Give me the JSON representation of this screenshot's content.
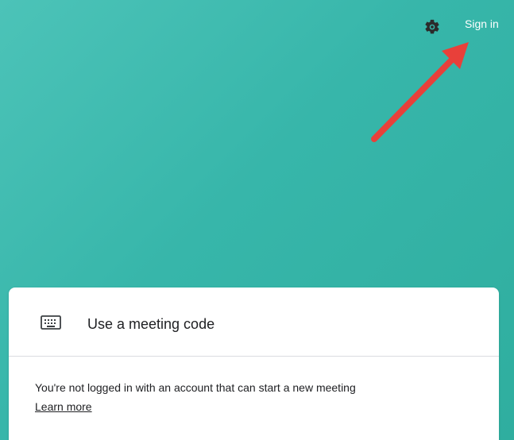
{
  "header": {
    "settings_icon": "gear-icon",
    "signin_label": "Sign in"
  },
  "card": {
    "meeting_code": {
      "icon": "keyboard-icon",
      "label": "Use a meeting code"
    },
    "notice": {
      "message": "You're not logged in with an account that can start a new meeting",
      "link_label": "Learn more"
    }
  },
  "colors": {
    "background": "#3db9ad",
    "arrow": "#e8403a",
    "card": "#ffffff",
    "text": "#202124"
  }
}
